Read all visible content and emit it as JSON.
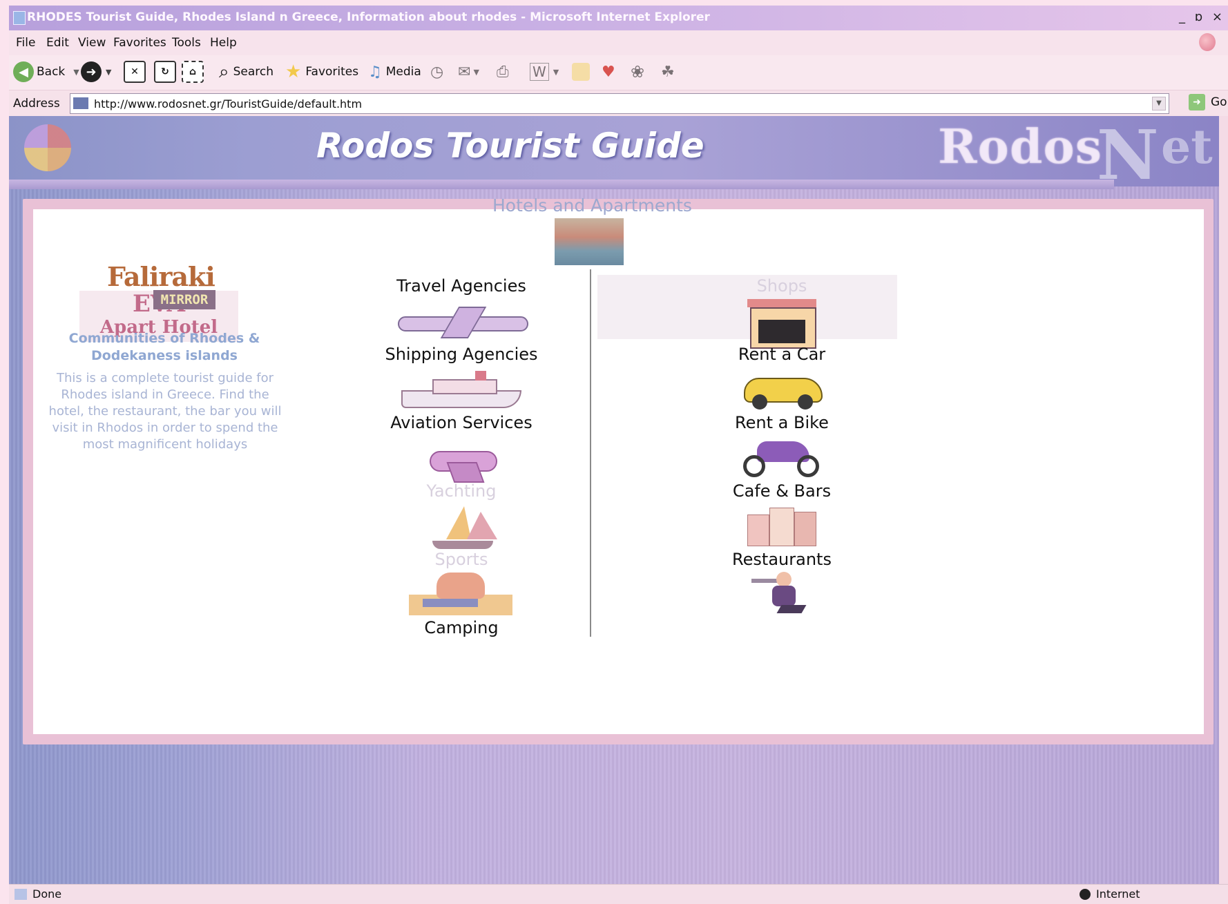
{
  "window": {
    "title": "RHODES Tourist Guide, Rhodes Island n Greece, Information about rhodes - Microsoft Internet Explorer",
    "controls": "_ ɒ ×"
  },
  "menubar": {
    "items": [
      "File",
      "Edit",
      "View",
      "Favorites",
      "Tools",
      "Help"
    ]
  },
  "toolbar": {
    "back": "Back",
    "search": "Search",
    "favorites": "Favorites",
    "media": "Media"
  },
  "addressbar": {
    "label": "Address",
    "url": "http://www.rodosnet.gr/TouristGuide/default.htm",
    "go": "Go"
  },
  "banner": {
    "title": "Rodos Tourist Guide",
    "logo_left": "Rodos",
    "logo_n": "N",
    "logo_right": "et"
  },
  "sidebar": {
    "eva_line1": "EVA",
    "eva_line2": "Apart Hotel",
    "mirror_line1": "Faliraki",
    "mirror_line2": "MIRROR",
    "communities": "Communities of Rhodes & Dodekaness islands",
    "intro": "This is a complete tourist guide for Rhodes island in Greece. Find the hotel, the restaurant, the bar you will visit in Rhodos in order to spend the most magnificent holidays"
  },
  "categories": {
    "hotels": "Hotels and Apartments",
    "left": [
      "Travel Agencies",
      "Shipping Agencies",
      "Aviation Services",
      "Yachting",
      "Sports",
      "Camping"
    ],
    "right": [
      "Shops",
      "Rent a Car",
      "Rent a Bike",
      "Cafe & Bars",
      "Restaurants"
    ]
  },
  "statusbar": {
    "status": "Done",
    "zone": "Internet"
  },
  "colors": {
    "banner": "#9da0d4",
    "content_frame": "#e9c1d6",
    "sidebar_text": "#8fa7d2",
    "faded_category": "#d8d0de"
  }
}
